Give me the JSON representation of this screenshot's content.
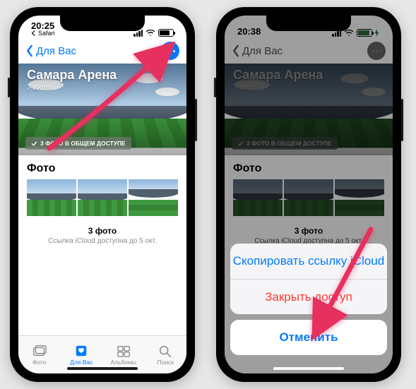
{
  "colors": {
    "accent": "#007aff",
    "destructive": "#ff3b30",
    "arrow": "#e6305e"
  },
  "phone1": {
    "status": {
      "time": "20:25",
      "back_app": "Safari"
    },
    "nav": {
      "back_label": "Для Вас"
    },
    "hero": {
      "title": "Самара Арена",
      "subtitle": "7 июля",
      "shared_badge": "3 ФОТО В ОБЩЕМ ДОСТУПЕ"
    },
    "section": {
      "title": "Фото",
      "count": "3 фото",
      "expiry": "Ссылка iCloud доступна до 5 окт."
    },
    "tabs": [
      {
        "label": "Фото"
      },
      {
        "label": "Для Вас"
      },
      {
        "label": "Альбомы"
      },
      {
        "label": "Поиск"
      }
    ]
  },
  "phone2": {
    "status": {
      "time": "20:38"
    },
    "nav": {
      "back_label": "Для Вас"
    },
    "hero": {
      "title": "Самара Арена",
      "subtitle": "7 июля",
      "shared_badge": "3 ФОТО В ОБЩЕМ ДОСТУПЕ"
    },
    "section": {
      "title": "Фото",
      "count": "3 фото",
      "expiry": "Ссылка iCloud доступна до 5 окт."
    },
    "action_sheet": {
      "copy": "Скопировать ссылку iCloud",
      "stop": "Закрыть доступ",
      "cancel": "Отменить"
    }
  }
}
